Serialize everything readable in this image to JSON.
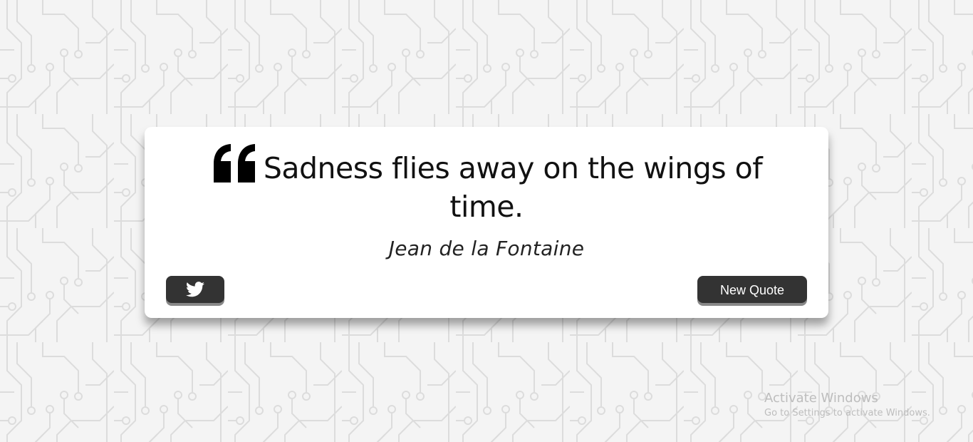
{
  "quote": {
    "text": "Sadness flies away on the wings of time.",
    "author": "Jean de la Fontaine",
    "quote_icon": "left-double-quote-icon"
  },
  "actions": {
    "tweet_icon": "twitter-icon",
    "new_quote_label": "New Quote"
  },
  "watermark": {
    "title": "Activate Windows",
    "subtitle": "Go to Settings to activate Windows."
  },
  "colors": {
    "button_bg": "#333333",
    "button_shadow": "#888888",
    "card_bg": "#ffffff",
    "page_bg": "#f4f4f4",
    "pattern_line": "#dcdcdc"
  }
}
